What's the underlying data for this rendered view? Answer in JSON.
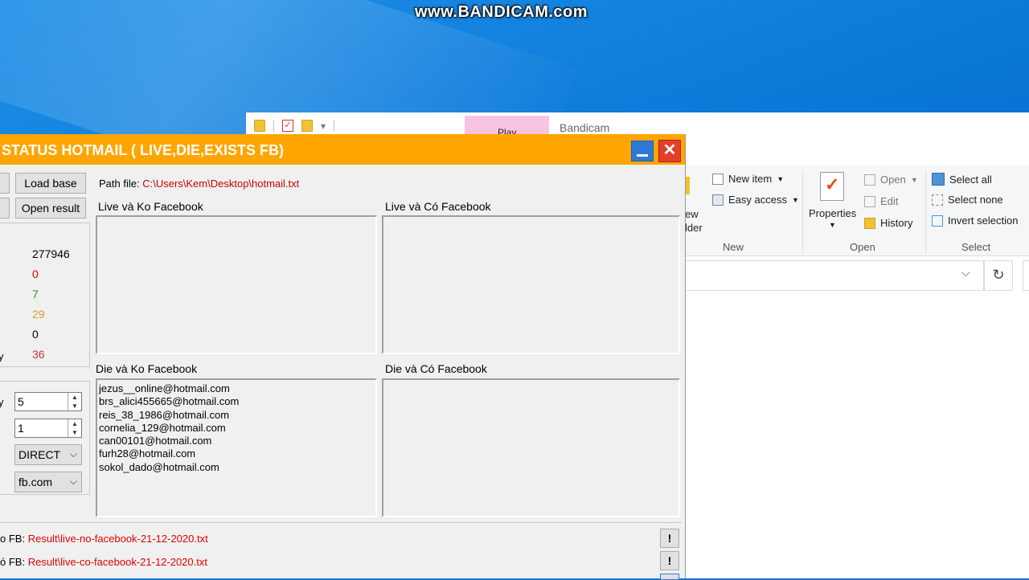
{
  "watermark": "www.BANDICAM.com",
  "explorer": {
    "play_tab": "Play",
    "title": "Bandicam",
    "view_partial": [
      "ew",
      "lder"
    ],
    "ribbon": {
      "new_item": "New item",
      "easy_access": "Easy access",
      "new_group": "New",
      "properties": "Properties",
      "open": "Open",
      "edit": "Edit",
      "history": "History",
      "open_group": "Open",
      "select_all": "Select all",
      "select_none": "Select none",
      "invert_selection": "Invert selection",
      "select_group": "Select"
    }
  },
  "tool": {
    "title": "STATUS HOTMAIL ( LIVE,DIE,EXISTS FB)",
    "load_base": "Load base",
    "open_result": "Open result",
    "path_label": "Path file:",
    "path_value": "C:\\Users\\Kem\\Desktop\\hotmail.txt",
    "stats": [
      {
        "value": "277946",
        "color": "#000000"
      },
      {
        "value": "0",
        "color": "#e00000"
      },
      {
        "value": "7",
        "color": "#2e8b2e"
      },
      {
        "value": "29",
        "color": "#d4a02a"
      },
      {
        "value": "0",
        "color": "#000000"
      },
      {
        "value": "36",
        "color": "#c0392b"
      }
    ],
    "stats_edge_label": "y",
    "panels": {
      "live_ko": "Live và Ko Facebook",
      "live_co": "Live và Có Facebook",
      "die_ko": "Die và Ko Facebook",
      "die_co": "Die và Có Facebook"
    },
    "die_ko_list": [
      "jezus__online@hotmail.com",
      "brs_alici455665@hotmail.com",
      "reis_38_1986@hotmail.com",
      "cornelia_129@hotmail.com",
      "can00101@hotmail.com",
      "furh28@hotmail.com",
      "sokol_dado@hotmail.com"
    ],
    "settings": {
      "threads_value": "5",
      "threads_edge_label": "y",
      "second_value": "1",
      "proxy_mode": "DIRECT",
      "domain": "fb.com"
    },
    "results": [
      {
        "prefix": "o FB:",
        "path": "Result\\live-no-facebook-21-12-2020.txt"
      },
      {
        "prefix": "ó FB:",
        "path": "Result\\live-co-facebook-21-12-2020.txt"
      }
    ],
    "bang": "!"
  }
}
